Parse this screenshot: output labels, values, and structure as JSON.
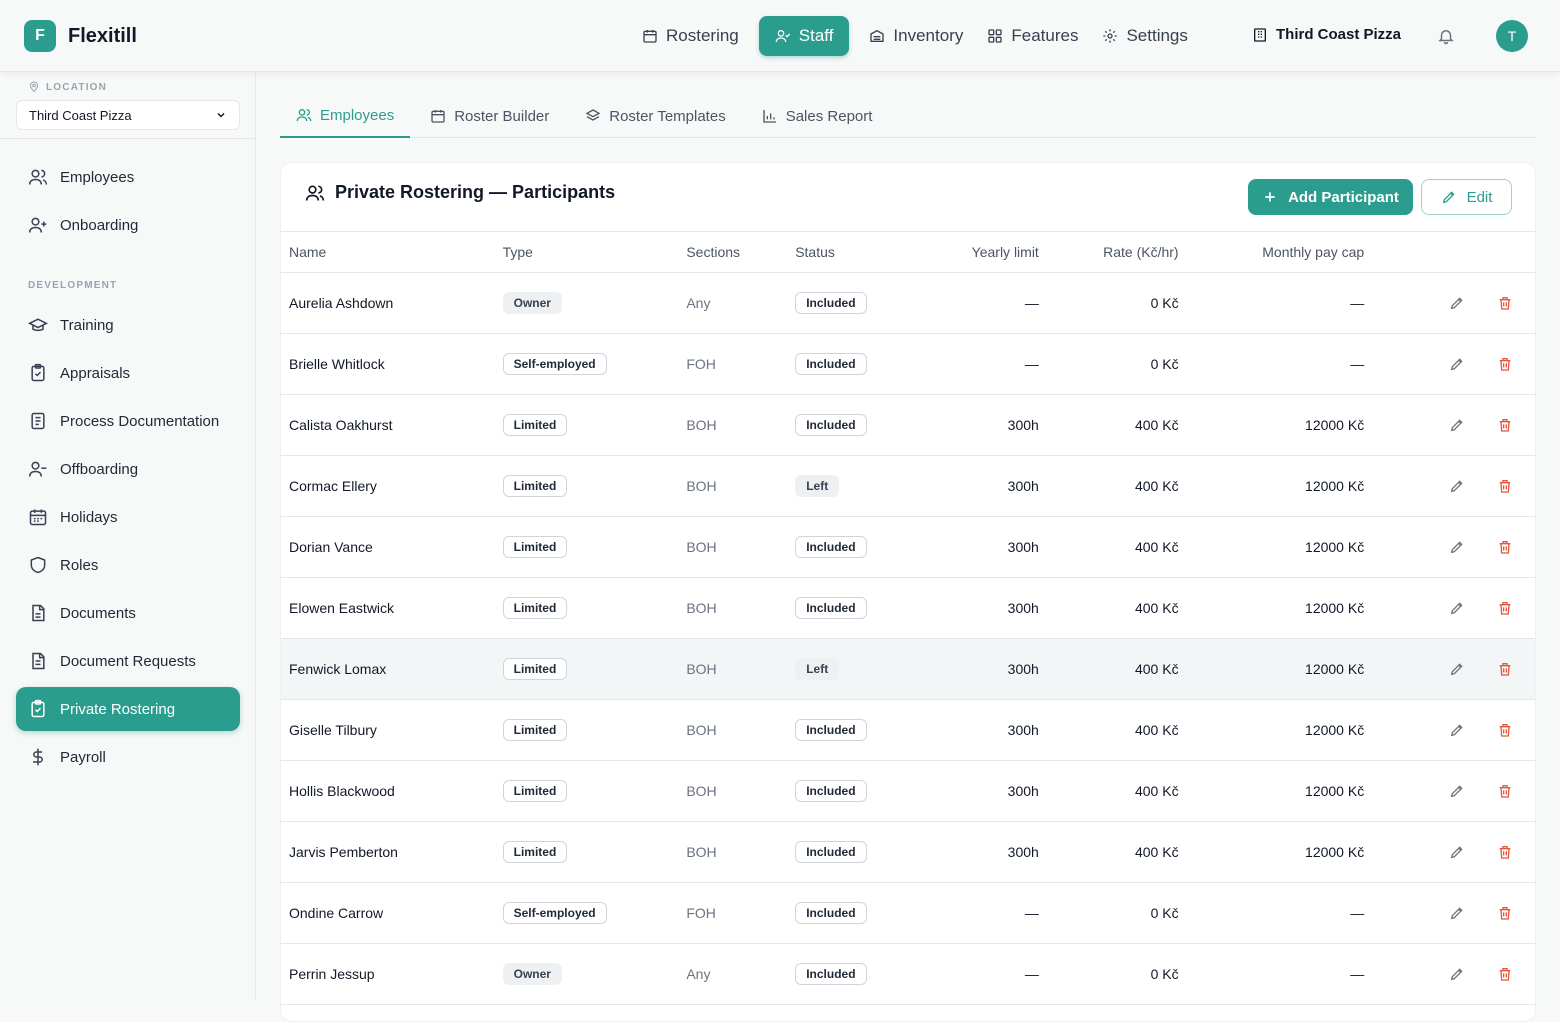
{
  "brand": {
    "logo_letter": "F",
    "name": "Flexitill"
  },
  "topnav": [
    {
      "label": "Rostering",
      "icon": "calendar-icon",
      "active": false
    },
    {
      "label": "Staff",
      "icon": "staff-icon",
      "active": true
    },
    {
      "label": "Inventory",
      "icon": "inventory-icon",
      "active": false
    },
    {
      "label": "Features",
      "icon": "grid-icon",
      "active": false
    },
    {
      "label": "Settings",
      "icon": "gear-icon",
      "active": false
    }
  ],
  "org": {
    "name": "Third Coast Pizza"
  },
  "user": {
    "initial": "T"
  },
  "sidebar": {
    "location_label": "LOCATION",
    "location_value": "Third Coast Pizza",
    "section_development": "DEVELOPMENT",
    "items": [
      {
        "label": "Employees"
      },
      {
        "label": "Onboarding"
      },
      {
        "label": "Training"
      },
      {
        "label": "Appraisals"
      },
      {
        "label": "Process Documentation"
      },
      {
        "label": "Offboarding"
      },
      {
        "label": "Holidays"
      },
      {
        "label": "Roles"
      },
      {
        "label": "Documents"
      },
      {
        "label": "Document Requests"
      },
      {
        "label": "Private Rostering"
      },
      {
        "label": "Payroll"
      }
    ]
  },
  "tabs": [
    {
      "label": "Employees"
    },
    {
      "label": "Roster Builder"
    },
    {
      "label": "Roster Templates"
    },
    {
      "label": "Sales Report"
    }
  ],
  "card": {
    "title": "Private Rostering — Participants",
    "add_label": "Add Participant",
    "edit_label": "Edit"
  },
  "table": {
    "headers": [
      "Name",
      "Type",
      "Sections",
      "Status",
      "Yearly limit",
      "Rate (Kč/hr)",
      "Monthly pay cap"
    ],
    "rows": [
      {
        "name": "Aurelia Ashdown",
        "type": "Owner",
        "sections": "Any",
        "status": "Included",
        "yearly": "—",
        "rate": "0 Kč",
        "cap": "—"
      },
      {
        "name": "Brielle Whitlock",
        "type": "Self-employed",
        "sections": "FOH",
        "status": "Included",
        "yearly": "—",
        "rate": "0 Kč",
        "cap": "—"
      },
      {
        "name": "Calista Oakhurst",
        "type": "Limited",
        "sections": "BOH",
        "status": "Included",
        "yearly": "300h",
        "rate": "400 Kč",
        "cap": "12000 Kč"
      },
      {
        "name": "Cormac Ellery",
        "type": "Limited",
        "sections": "BOH",
        "status": "Left",
        "yearly": "300h",
        "rate": "400 Kč",
        "cap": "12000 Kč"
      },
      {
        "name": "Dorian Vance",
        "type": "Limited",
        "sections": "BOH",
        "status": "Included",
        "yearly": "300h",
        "rate": "400 Kč",
        "cap": "12000 Kč"
      },
      {
        "name": "Elowen Eastwick",
        "type": "Limited",
        "sections": "BOH",
        "status": "Included",
        "yearly": "300h",
        "rate": "400 Kč",
        "cap": "12000 Kč"
      },
      {
        "name": "Fenwick Lomax",
        "type": "Limited",
        "sections": "BOH",
        "status": "Left",
        "yearly": "300h",
        "rate": "400 Kč",
        "cap": "12000 Kč"
      },
      {
        "name": "Giselle Tilbury",
        "type": "Limited",
        "sections": "BOH",
        "status": "Included",
        "yearly": "300h",
        "rate": "400 Kč",
        "cap": "12000 Kč"
      },
      {
        "name": "Hollis Blackwood",
        "type": "Limited",
        "sections": "BOH",
        "status": "Included",
        "yearly": "300h",
        "rate": "400 Kč",
        "cap": "12000 Kč"
      },
      {
        "name": "Jarvis Pemberton",
        "type": "Limited",
        "sections": "BOH",
        "status": "Included",
        "yearly": "300h",
        "rate": "400 Kč",
        "cap": "12000 Kč"
      },
      {
        "name": "Ondine Carrow",
        "type": "Self-employed",
        "sections": "FOH",
        "status": "Included",
        "yearly": "—",
        "rate": "0 Kč",
        "cap": "—"
      },
      {
        "name": "Perrin Jessup",
        "type": "Owner",
        "sections": "Any",
        "status": "Included",
        "yearly": "—",
        "rate": "0 Kč",
        "cap": "—"
      }
    ]
  },
  "colors": {
    "accent": "#2a9d8f",
    "danger": "#e4573d"
  }
}
